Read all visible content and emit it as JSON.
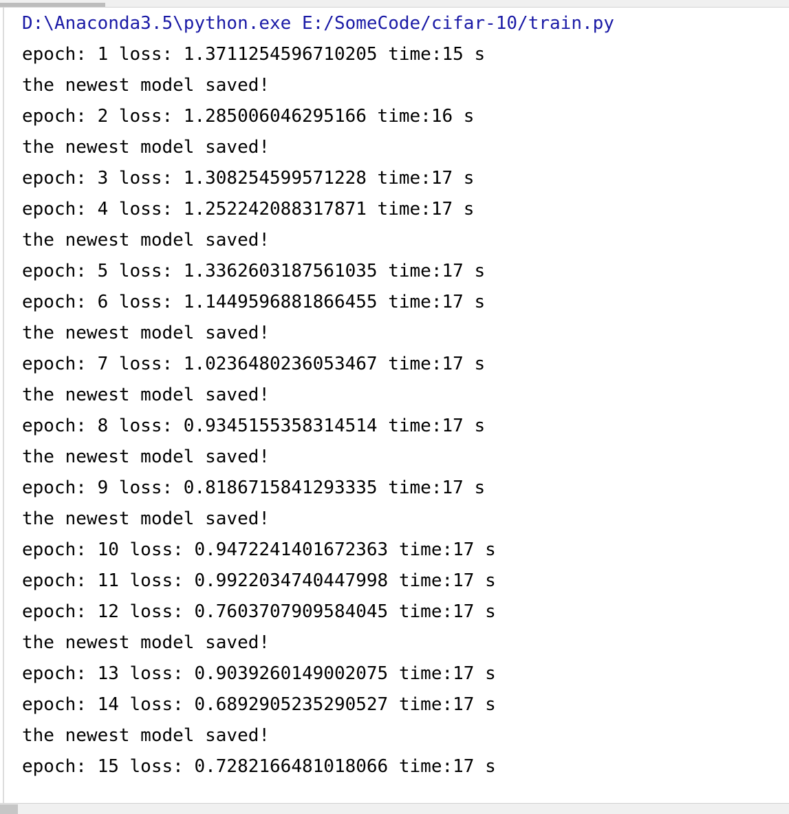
{
  "console": {
    "command": "D:\\Anaconda3.5\\python.exe E:/SomeCode/cifar-10/train.py",
    "lines": [
      "epoch: 1 loss: 1.3711254596710205 time:15 s",
      "the newest model saved!",
      "epoch: 2 loss: 1.285006046295166 time:16 s",
      "the newest model saved!",
      "epoch: 3 loss: 1.308254599571228 time:17 s",
      "epoch: 4 loss: 1.252242088317871 time:17 s",
      "the newest model saved!",
      "epoch: 5 loss: 1.3362603187561035 time:17 s",
      "epoch: 6 loss: 1.1449596881866455 time:17 s",
      "the newest model saved!",
      "epoch: 7 loss: 1.0236480236053467 time:17 s",
      "the newest model saved!",
      "epoch: 8 loss: 0.9345155358314514 time:17 s",
      "the newest model saved!",
      "epoch: 9 loss: 0.8186715841293335 time:17 s",
      "the newest model saved!",
      "epoch: 10 loss: 0.9472241401672363 time:17 s",
      "epoch: 11 loss: 0.9922034740447998 time:17 s",
      "epoch: 12 loss: 0.7603707909584045 time:17 s",
      "the newest model saved!",
      "epoch: 13 loss: 0.9039260149002075 time:17 s",
      "epoch: 14 loss: 0.6892905235290527 time:17 s",
      "the newest model saved!",
      "epoch: 15 loss: 0.7282166481018066 time:17 s"
    ]
  },
  "colors": {
    "command": "#1a1aa6",
    "output": "#000000"
  }
}
